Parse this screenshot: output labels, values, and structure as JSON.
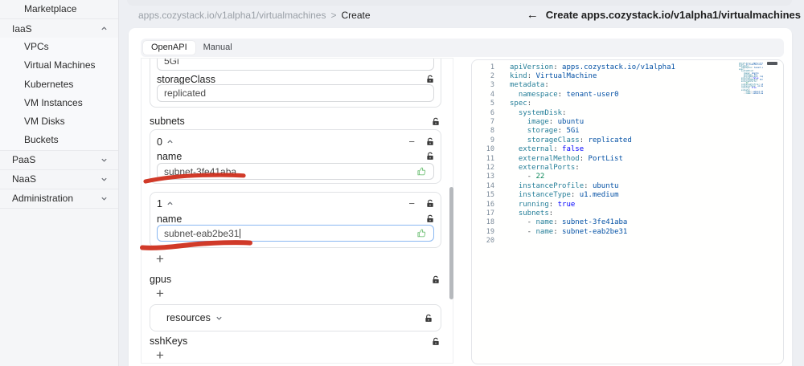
{
  "sidebar": {
    "sections": [
      {
        "kind": "item",
        "label": "Marketplace"
      },
      {
        "kind": "group",
        "label": "IaaS",
        "expanded": true,
        "children": [
          "VPCs",
          "Virtual Machines",
          "Kubernetes",
          "VM Instances",
          "VM Disks",
          "Buckets"
        ]
      },
      {
        "kind": "group",
        "label": "PaaS",
        "expanded": false,
        "children": []
      },
      {
        "kind": "group",
        "label": "NaaS",
        "expanded": false,
        "children": []
      },
      {
        "kind": "group",
        "label": "Administration",
        "expanded": false,
        "children": []
      }
    ]
  },
  "breadcrumb": {
    "path": "apps.cozystack.io/v1alpha1/virtualmachines",
    "separator": ">",
    "current": "Create"
  },
  "header": {
    "back_icon": "←",
    "title": "Create apps.cozystack.io/v1alpha1/virtualmachines"
  },
  "tabs": [
    {
      "label": "OpenAPI",
      "active": true
    },
    {
      "label": "Manual",
      "active": false
    }
  ],
  "form": {
    "system_disk_card": {
      "partial_input_value": "5Gi",
      "storage_class_label": "storageClass",
      "storage_class_value": "replicated"
    },
    "subnets": {
      "label": "subnets",
      "items": [
        {
          "index": "0",
          "name_label": "name",
          "value": "subnet-3fe41aba",
          "focused": false
        },
        {
          "index": "1",
          "name_label": "name",
          "value": "subnet-eab2be31",
          "focused": true
        }
      ],
      "minus_label": "−",
      "add_label": "+"
    },
    "gpus": {
      "label": "gpus",
      "add_label": "+"
    },
    "resources": {
      "label": "resources"
    },
    "ssh_keys": {
      "label": "sshKeys",
      "add_label": "+"
    }
  },
  "editor": {
    "language": "yaml",
    "lines": [
      {
        "n": "1",
        "tokens": [
          [
            "key",
            "apiVersion"
          ],
          [
            "p",
            ": "
          ],
          [
            "str",
            "apps.cozystack.io/v1alpha1"
          ]
        ]
      },
      {
        "n": "2",
        "tokens": [
          [
            "key",
            "kind"
          ],
          [
            "p",
            ": "
          ],
          [
            "str",
            "VirtualMachine"
          ]
        ]
      },
      {
        "n": "3",
        "tokens": [
          [
            "key",
            "metadata"
          ],
          [
            "p",
            ":"
          ]
        ]
      },
      {
        "n": "4",
        "tokens": [
          [
            "p",
            "  "
          ],
          [
            "key",
            "namespace"
          ],
          [
            "p",
            ": "
          ],
          [
            "str",
            "tenant-user0"
          ]
        ]
      },
      {
        "n": "5",
        "tokens": [
          [
            "key",
            "spec"
          ],
          [
            "p",
            ":"
          ]
        ]
      },
      {
        "n": "6",
        "tokens": [
          [
            "p",
            "  "
          ],
          [
            "key",
            "systemDisk"
          ],
          [
            "p",
            ":"
          ]
        ]
      },
      {
        "n": "7",
        "tokens": [
          [
            "p",
            "    "
          ],
          [
            "key",
            "image"
          ],
          [
            "p",
            ": "
          ],
          [
            "str",
            "ubuntu"
          ]
        ]
      },
      {
        "n": "8",
        "tokens": [
          [
            "p",
            "    "
          ],
          [
            "key",
            "storage"
          ],
          [
            "p",
            ": "
          ],
          [
            "str",
            "5Gi"
          ]
        ]
      },
      {
        "n": "9",
        "tokens": [
          [
            "p",
            "    "
          ],
          [
            "key",
            "storageClass"
          ],
          [
            "p",
            ": "
          ],
          [
            "str",
            "replicated"
          ]
        ]
      },
      {
        "n": "10",
        "tokens": [
          [
            "p",
            "  "
          ],
          [
            "key",
            "external"
          ],
          [
            "p",
            ": "
          ],
          [
            "kw",
            "false"
          ]
        ]
      },
      {
        "n": "11",
        "tokens": [
          [
            "p",
            "  "
          ],
          [
            "key",
            "externalMethod"
          ],
          [
            "p",
            ": "
          ],
          [
            "str",
            "PortList"
          ]
        ]
      },
      {
        "n": "12",
        "tokens": [
          [
            "p",
            "  "
          ],
          [
            "key",
            "externalPorts"
          ],
          [
            "p",
            ":"
          ]
        ]
      },
      {
        "n": "13",
        "tokens": [
          [
            "p",
            "    - "
          ],
          [
            "num",
            "22"
          ]
        ]
      },
      {
        "n": "14",
        "tokens": [
          [
            "p",
            "  "
          ],
          [
            "key",
            "instanceProfile"
          ],
          [
            "p",
            ": "
          ],
          [
            "str",
            "ubuntu"
          ]
        ]
      },
      {
        "n": "15",
        "tokens": [
          [
            "p",
            "  "
          ],
          [
            "key",
            "instanceType"
          ],
          [
            "p",
            ": "
          ],
          [
            "str",
            "u1.medium"
          ]
        ]
      },
      {
        "n": "16",
        "tokens": [
          [
            "p",
            "  "
          ],
          [
            "key",
            "running"
          ],
          [
            "p",
            ": "
          ],
          [
            "kw",
            "true"
          ]
        ]
      },
      {
        "n": "17",
        "tokens": [
          [
            "p",
            "  "
          ],
          [
            "key",
            "subnets"
          ],
          [
            "p",
            ":"
          ]
        ]
      },
      {
        "n": "18",
        "tokens": [
          [
            "p",
            "    - "
          ],
          [
            "key",
            "name"
          ],
          [
            "p",
            ": "
          ],
          [
            "str",
            "subnet-3fe41aba"
          ]
        ]
      },
      {
        "n": "19",
        "tokens": [
          [
            "p",
            "    - "
          ],
          [
            "key",
            "name"
          ],
          [
            "p",
            ": "
          ],
          [
            "str",
            "subnet-eab2be31"
          ]
        ]
      },
      {
        "n": "20",
        "tokens": []
      }
    ]
  },
  "colors": {
    "annotation_red": "#cf2f1d",
    "yaml_key": "#267f99",
    "yaml_string": "#0451a5",
    "yaml_keyword": "#0000ff",
    "yaml_number": "#098658",
    "focus_border": "#8ab8f2",
    "like_green": "#74c27a"
  }
}
